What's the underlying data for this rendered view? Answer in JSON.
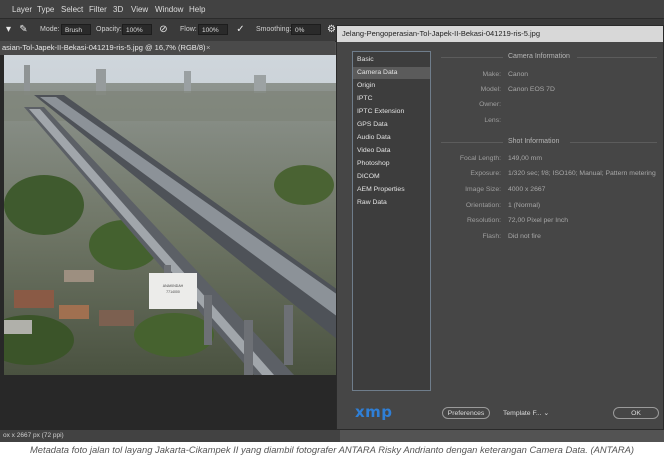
{
  "menubar": {
    "items": [
      "Layer",
      "Type",
      "Select",
      "Filter",
      "3D",
      "View",
      "Window",
      "Help"
    ]
  },
  "options": {
    "mode_label": "Mode:",
    "mode_value": "Brush",
    "opacity_label": "Opacity:",
    "opacity_value": "100%",
    "flow_label": "Flow:",
    "flow_value": "100%",
    "smoothing_label": "Smoothing:",
    "smoothing_value": "0%"
  },
  "document": {
    "tab_title": "asian-Tol-Japek-II-Bekasi-041219-ris-5.jpg @ 16,7% (RGB/8)",
    "status": "ox x 2667 px (72 ppi)"
  },
  "billboard": {
    "line1": "ANAKINDAH",
    "line2": "7714000"
  },
  "dialog": {
    "title": "Jelang-Pengoperasian-Tol-Japek-II-Bekasi-041219-ris-5.jpg",
    "sidebar_items": [
      "Basic",
      "Camera Data",
      "Origin",
      "IPTC",
      "IPTC Extension",
      "GPS Data",
      "Audio Data",
      "Video Data",
      "Photoshop",
      "DICOM",
      "AEM Properties",
      "Raw Data"
    ],
    "selected_index": 1,
    "camera_section": "Camera Information",
    "camera_fields": [
      {
        "label": "Make:",
        "value": "Canon"
      },
      {
        "label": "Model:",
        "value": "Canon EOS 7D"
      },
      {
        "label": "Owner:",
        "value": ""
      },
      {
        "label": "Lens:",
        "value": ""
      }
    ],
    "shot_section": "Shot Information",
    "shot_fields": [
      {
        "label": "Focal Length:",
        "value": "149,00 mm"
      },
      {
        "label": "Exposure:",
        "value": "1/320 sec;  f/8;  ISO160;  Manual;  Pattern metering"
      },
      {
        "label": "Image Size:",
        "value": "4000 x 2667"
      },
      {
        "label": "Orientation:",
        "value": "1 (Normal)"
      },
      {
        "label": "Resolution:",
        "value": "72,00 Pixel per Inch"
      },
      {
        "label": "Flash:",
        "value": "Did not fire"
      }
    ],
    "logo": "xmp",
    "preferences_label": "Preferences",
    "template_label": "Template F...",
    "ok_label": "OK"
  },
  "caption": "Metadata foto jalan tol layang Jakarta-Cikampek II yang diambil fotografer ANTARA Risky Andrianto dengan keterangan Camera Data. (ANTARA)",
  "colors": {
    "accent": "#2f7fd6",
    "panel": "#464646",
    "title_bar": "#d8d8d8"
  }
}
